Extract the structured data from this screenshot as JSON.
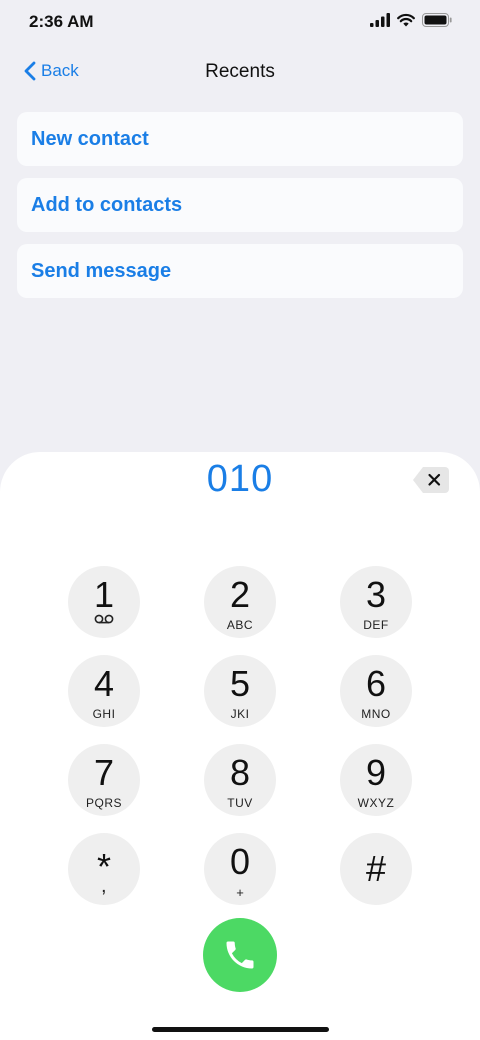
{
  "status_bar": {
    "time": "2:36 AM",
    "icons": [
      "signal-icon",
      "wifi-icon",
      "battery-icon"
    ]
  },
  "nav": {
    "back_label": "Back",
    "title": "Recents"
  },
  "actions": [
    {
      "label": "New contact"
    },
    {
      "label": "Add to contacts"
    },
    {
      "label": "Send message"
    }
  ],
  "dialer": {
    "number": "010",
    "keys": [
      {
        "digit": "1",
        "letters": "",
        "icon": "voicemail-icon"
      },
      {
        "digit": "2",
        "letters": "ABC"
      },
      {
        "digit": "3",
        "letters": "DEF"
      },
      {
        "digit": "4",
        "letters": "GHI"
      },
      {
        "digit": "5",
        "letters": "JKI"
      },
      {
        "digit": "6",
        "letters": "MNO"
      },
      {
        "digit": "7",
        "letters": "PQRS"
      },
      {
        "digit": "8",
        "letters": "TUV"
      },
      {
        "digit": "9",
        "letters": "WXYZ"
      },
      {
        "digit": "*",
        "letters": ","
      },
      {
        "digit": "0",
        "letters": "+"
      },
      {
        "digit": "#",
        "letters": ""
      }
    ]
  },
  "colors": {
    "accent": "#1a7ee6",
    "call_green": "#4cd964",
    "key_bg": "#efefef",
    "background": "#efeff4"
  }
}
